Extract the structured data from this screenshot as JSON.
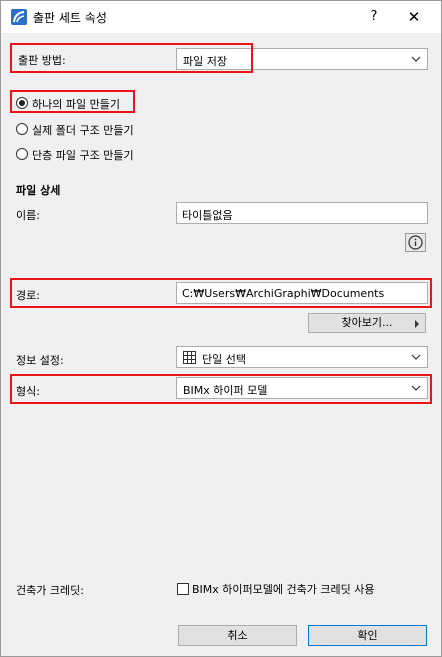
{
  "window": {
    "title": "출판 세트 속성",
    "help": "?",
    "close": "✕"
  },
  "publish_method": {
    "label": "출판 방법:",
    "value": "파일 저장"
  },
  "structure_options": [
    {
      "label": "하나의 파일 만들기",
      "selected": true
    },
    {
      "label": "실제 폴더 구조 만들기",
      "selected": false
    },
    {
      "label": "단층 파일 구조 만들기",
      "selected": false
    }
  ],
  "file_details": {
    "heading": "파일 상세",
    "name_label": "이름:",
    "name_value": "타이틀없음"
  },
  "path": {
    "label": "경로:",
    "value": "C:₩Users₩ArchiGraphi₩Documents",
    "browse_label": "찾아보기..."
  },
  "info_settings": {
    "label": "정보 설정:",
    "value": "단일 선택"
  },
  "format": {
    "label": "형식:",
    "value": "BIMx 하이퍼 모델"
  },
  "building_credit": {
    "label": "건축가 크레딧:",
    "checkbox_label": "BIMx 하이퍼모델에 건축가 크레딧 사용",
    "checked": false
  },
  "buttons": {
    "cancel": "취소",
    "ok": "확인"
  },
  "colors": {
    "highlight": "#e8161b",
    "primary_border": "#0078d7"
  }
}
